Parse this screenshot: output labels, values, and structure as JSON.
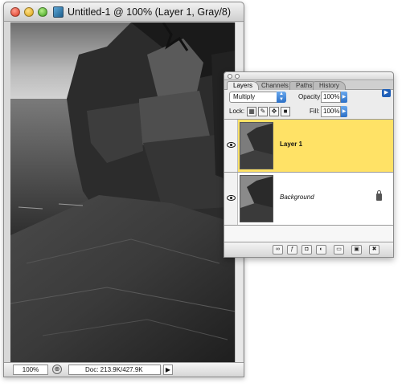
{
  "document_window": {
    "title": "Untitled-1 @ 100% (Layer 1, Gray/8)",
    "status": {
      "zoom": "100%",
      "doc_size": "Doc: 213.9K/427.9K"
    }
  },
  "layers_panel": {
    "tabs": [
      {
        "label": "Layers",
        "active": true
      },
      {
        "label": "Channels",
        "active": false
      },
      {
        "label": "Paths",
        "active": false
      },
      {
        "label": "History",
        "active": false
      }
    ],
    "blend_mode": "Multiply",
    "opacity_label": "Opacity:",
    "opacity_value": "100%",
    "lock_label": "Lock:",
    "fill_label": "Fill:",
    "fill_value": "100%",
    "layers": [
      {
        "name": "Layer 1",
        "selected": true,
        "visible": true,
        "locked": false
      },
      {
        "name": "Background",
        "selected": false,
        "visible": true,
        "locked": true
      }
    ],
    "selection_color": "#ffe266"
  },
  "icons": {
    "window_controls": [
      "close-icon",
      "minimize-icon",
      "zoom-icon"
    ],
    "lock_buttons": [
      "lock-transparency-icon",
      "lock-image-icon",
      "lock-position-icon",
      "lock-all-icon"
    ],
    "panel_buttons": [
      "link-layers-icon",
      "layer-style-icon",
      "layer-mask-icon",
      "adjustment-layer-icon",
      "new-group-icon",
      "new-layer-icon",
      "trash-icon"
    ]
  }
}
